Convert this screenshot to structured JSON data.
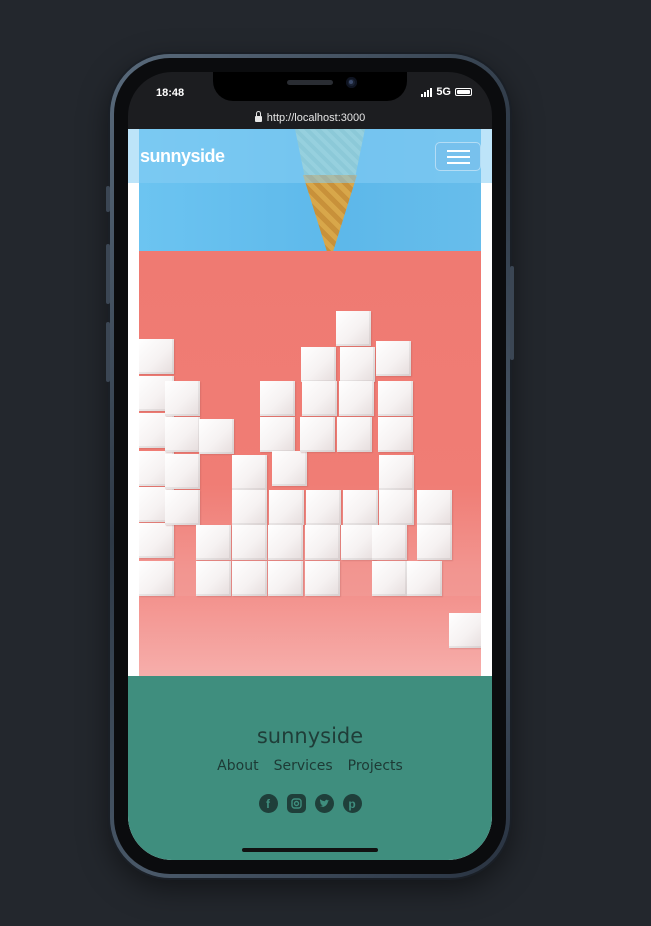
{
  "status": {
    "time": "18:48",
    "network": "5G"
  },
  "browser": {
    "url": "http://localhost:3000"
  },
  "header": {
    "logo": "sunnyside",
    "menu_icon": "hamburger-menu-icon"
  },
  "footer": {
    "logo": "sunnyside",
    "links": [
      "About",
      "Services",
      "Projects"
    ],
    "social": [
      "facebook-icon",
      "instagram-icon",
      "twitter-icon",
      "pinterest-icon"
    ]
  },
  "colors": {
    "background": "#23272d",
    "header_blue": "#6cc4f1",
    "hero_coral": "#ef7a72",
    "footer_green": "#3f8e7e"
  }
}
